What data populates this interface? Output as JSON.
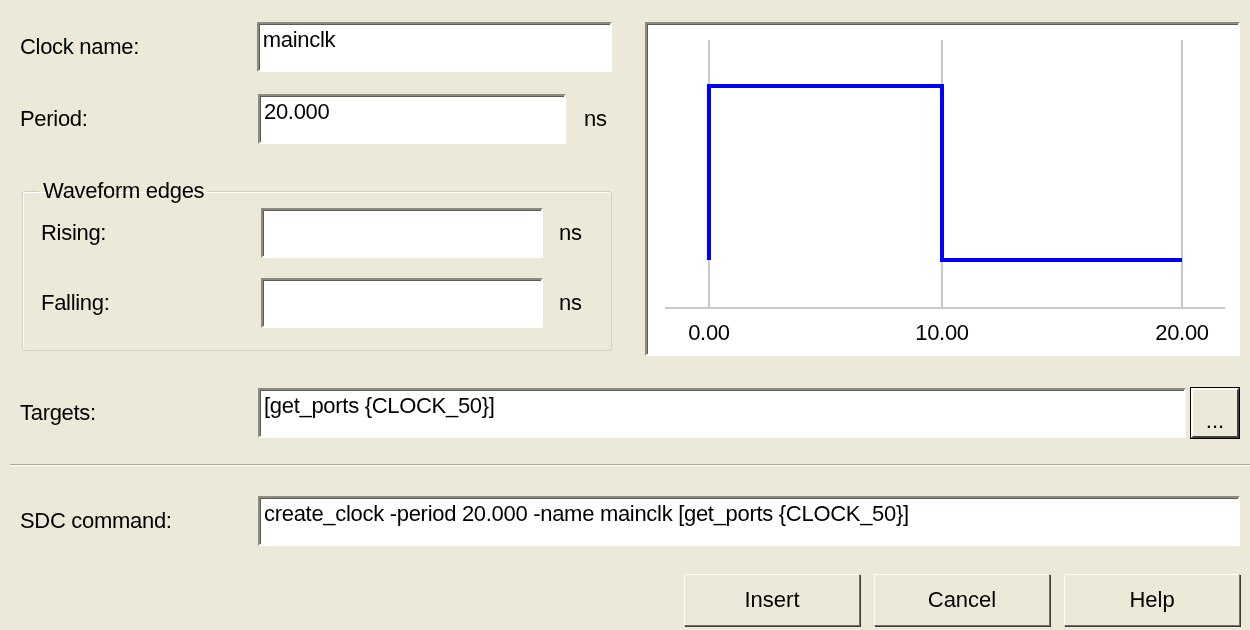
{
  "clock_name": {
    "label": "Clock name:",
    "value": "mainclk"
  },
  "period": {
    "label": "Period:",
    "value": "20.000",
    "unit": "ns"
  },
  "waveform_edges": {
    "title": "Waveform edges",
    "fields": [
      {
        "label": "Rising:",
        "unit": "ns"
      },
      {
        "label": "Falling:",
        "unit": "ns"
      }
    ]
  },
  "waveform": {
    "tick_labels": [
      "0.00",
      "10.00",
      "20.00"
    ]
  },
  "targets": {
    "label": "Targets:",
    "value": "[get_ports {CLOCK_50}]",
    "browse_button": "..."
  },
  "sdc_command": {
    "label": "SDC command:",
    "value": "create_clock -period 20.000 -name mainclk [get_ports {CLOCK_50}]"
  },
  "buttons": [
    "Insert",
    "Cancel",
    "Help"
  ]
}
